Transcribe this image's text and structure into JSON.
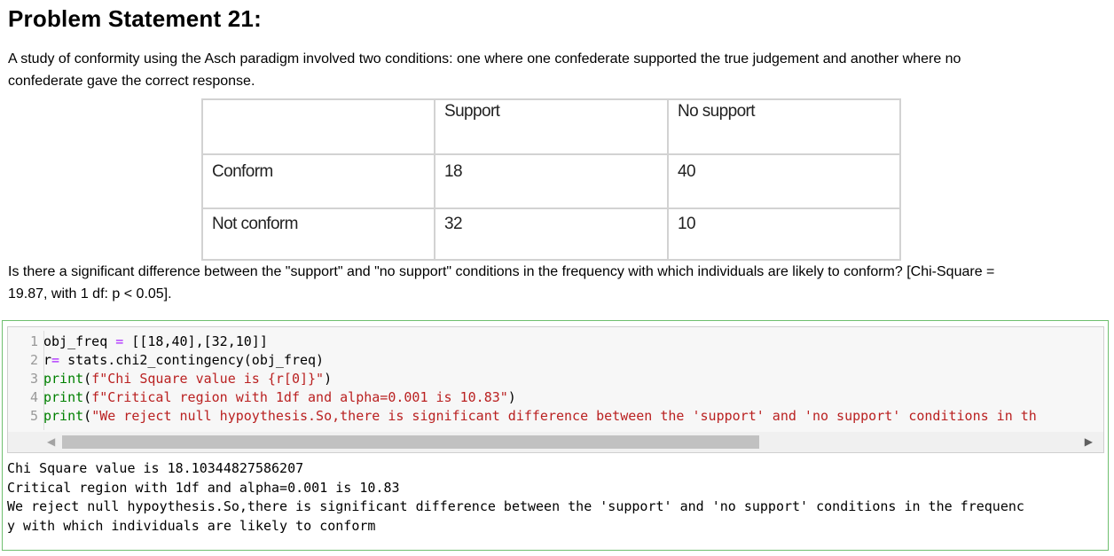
{
  "title": "Problem Statement 21:",
  "intro_line1": "A study of conformity using the Asch paradigm involved two conditions: one where one confederate supported the true judgement and another where no",
  "intro_line2": "confederate gave the correct response.",
  "table": {
    "headers": [
      "",
      "Support",
      "No support"
    ],
    "rows": [
      [
        "Conform",
        "18",
        "40"
      ],
      [
        "Not conform",
        "32",
        "10"
      ]
    ]
  },
  "question_line1": "Is there a significant difference between the \"support\" and \"no support\" conditions in the frequency with which individuals are likely to conform? [Chi-Square =",
  "question_line2": "19.87, with 1 df: p < 0.05].",
  "code": {
    "line_numbers": [
      "1",
      "2",
      "3",
      "4",
      "5"
    ],
    "l1": {
      "var": "obj_freq",
      "op": " = ",
      "rest": "[[18,40],[32,10]]"
    },
    "l2": {
      "var": "r",
      "op": "= ",
      "rest": "stats.chi2_contingency(obj_freq)"
    },
    "l3": {
      "fn": "print",
      "p1": "(",
      "str": "f\"Chi Square value is {r[0]}\"",
      "p2": ")"
    },
    "l4": {
      "fn": "print",
      "p1": "(",
      "str": "f\"Critical region with 1df and alpha=0.001 is 10.83\"",
      "p2": ")"
    },
    "l5": {
      "fn": "print",
      "p1": "(",
      "str": "\"We reject null hypoythesis.So,there is significant difference between the 'support' and 'no support' conditions in th"
    }
  },
  "output_lines": [
    "Chi Square value is 18.10344827586207",
    "Critical region with 1df and alpha=0.001 is 10.83",
    "We reject null hypoythesis.So,there is significant difference between the 'support' and 'no support' conditions in the frequenc",
    "y with which individuals are likely to conform"
  ],
  "colors": {
    "keyword": "#008000",
    "string": "#ba2121",
    "operator": "#aa22ff",
    "cell_border": "#6fbf6f"
  }
}
